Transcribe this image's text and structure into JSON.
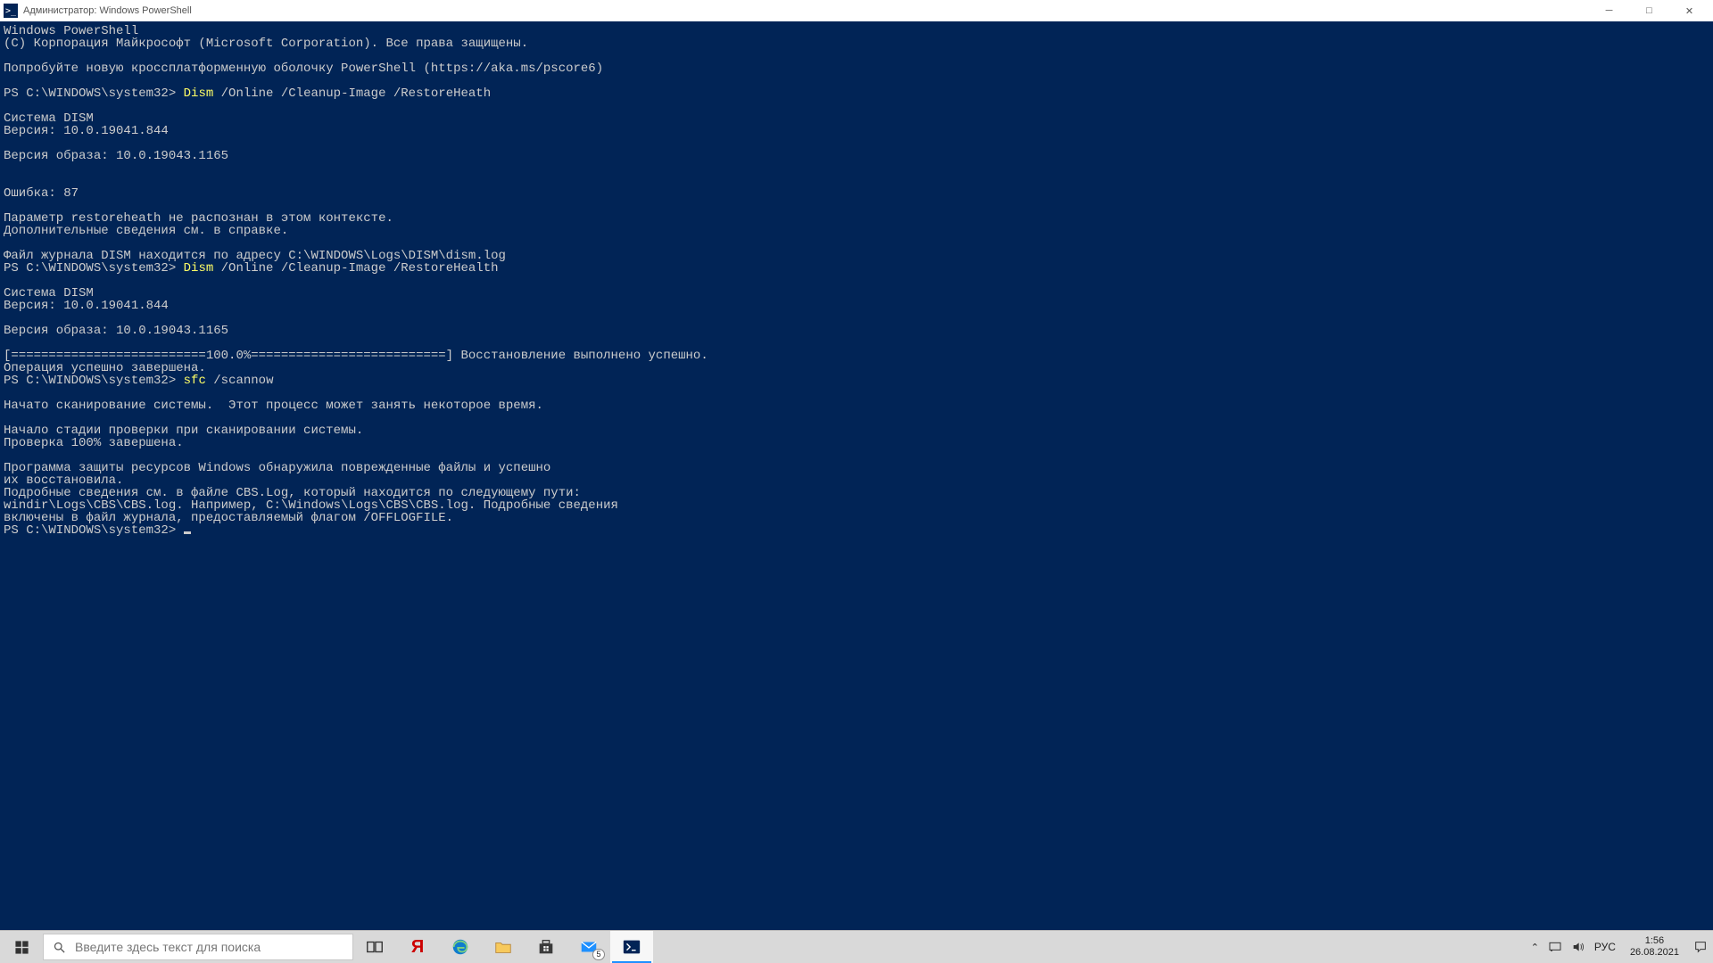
{
  "window": {
    "title": "Администратор: Windows PowerShell",
    "icon_glyph": ">_"
  },
  "terminal": {
    "header_line1": "Windows PowerShell",
    "header_line2": "(C) Корпорация Майкрософт (Microsoft Corporation). Все права защищены.",
    "pscore_hint": "Попробуйте новую кроссплатформенную оболочку PowerShell (https://aka.ms/pscore6)",
    "prompt": "PS C:\\WINDOWS\\system32>",
    "cmd1_head": "Dism",
    "cmd1_tail": " /Online /Cleanup-Image /RestoreHeath",
    "dism_system": "Cистема DISM",
    "dism_version": "Версия: 10.0.19041.844",
    "image_version": "Версия образа: 10.0.19043.1165",
    "error_code": "Ошибка: 87",
    "err_l1": "Параметр restoreheath не распознан в этом контексте.",
    "err_l2": "Дополнительные сведения см. в справке.",
    "log_line": "Файл журнала DISM находится по адресу C:\\WINDOWS\\Logs\\DISM\\dism.log",
    "cmd2_head": "Dism",
    "cmd2_tail": " /Online /Cleanup-Image /RestoreHealth",
    "progress_line": "[==========================100.0%==========================] Восстановление выполнено успешно.",
    "op_done": "Операция успешно завершена.",
    "cmd3_head": "sfc",
    "cmd3_tail": " /scannow",
    "scan_start": "Начато сканирование системы.  Этот процесс может занять некоторое время.",
    "scan_begin": "Начало стадии проверки при сканировании системы.",
    "scan_done": "Проверка 100% завершена.",
    "sfc_l1": "Программа защиты ресурсов Windows обнаружила поврежденные файлы и успешно",
    "sfc_l2": "их восстановила.",
    "sfc_l3": "Подробные сведения см. в файле CBS.Log, который находится по следующему пути:",
    "sfc_l4": "windir\\Logs\\CBS\\CBS.log. Например, C:\\Windows\\Logs\\CBS\\CBS.log. Подробные сведения",
    "sfc_l5": "включены в файл журнала, предоставляемый флагом /OFFLOGFILE."
  },
  "taskbar": {
    "search_placeholder": "Введите здесь текст для поиска",
    "mail_badge": "5",
    "lang": "РУС",
    "time": "1:56",
    "date": "26.08.2021"
  }
}
